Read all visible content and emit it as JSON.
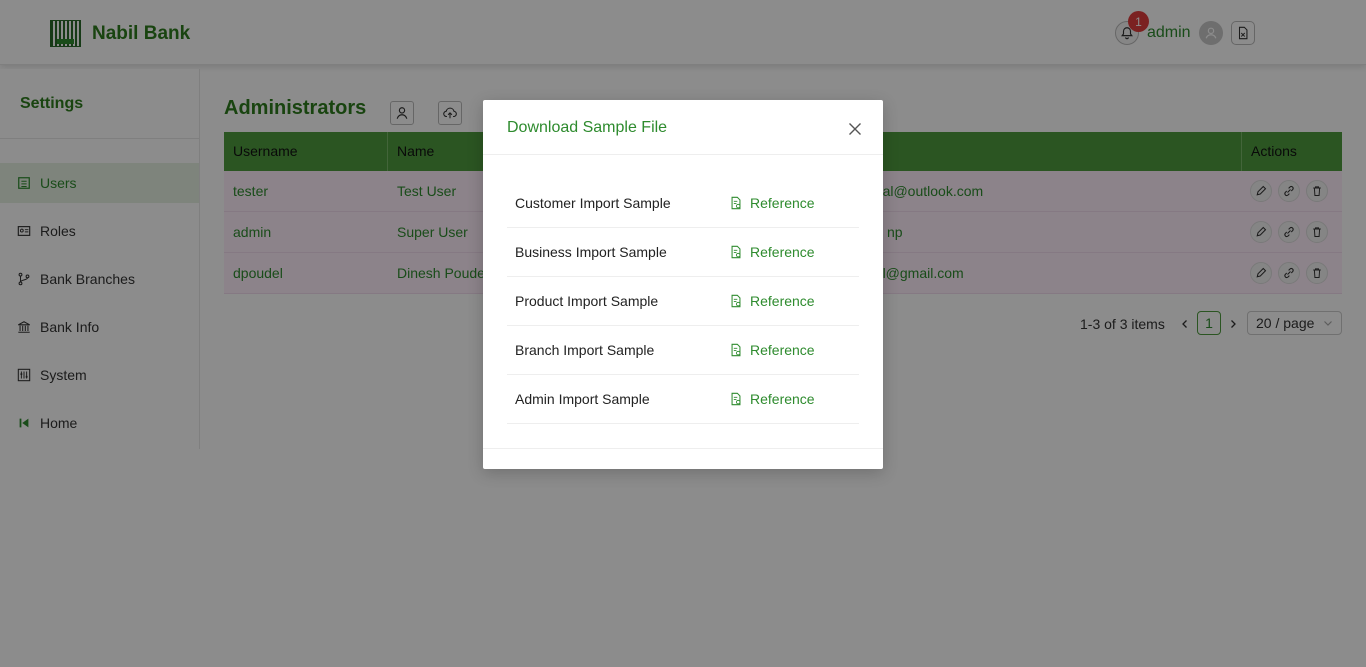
{
  "header": {
    "brand": "Nabil Bank",
    "notification_count": "1",
    "user_name": "admin"
  },
  "sidebar": {
    "title": "Settings",
    "items": [
      {
        "label": "Users",
        "icon": "users-icon",
        "active": true
      },
      {
        "label": "Roles",
        "icon": "id-card-icon",
        "active": false
      },
      {
        "label": "Bank Branches",
        "icon": "branch-icon",
        "active": false
      },
      {
        "label": "Bank Info",
        "icon": "bank-icon",
        "active": false
      },
      {
        "label": "System",
        "icon": "system-icon",
        "active": false
      },
      {
        "label": "Home",
        "icon": "home-back-icon",
        "active": false
      }
    ]
  },
  "main": {
    "title": "Administrators",
    "table": {
      "columns": [
        "Username",
        "Name",
        "",
        "Actions"
      ],
      "rows": [
        {
          "username": "tester",
          "name": "Test User",
          "email": "epal@outlook.com"
        },
        {
          "username": "admin",
          "name": "Super User",
          "email": "np"
        },
        {
          "username": "dpoudel",
          "name": "Dinesh Poude",
          "email": "pal@gmail.com"
        }
      ]
    },
    "pagination": {
      "summary": "1-3 of 3 items",
      "current_page": "1",
      "page_size": "20 / page"
    }
  },
  "modal": {
    "title": "Download Sample File",
    "samples": [
      {
        "name": "Customer Import Sample",
        "link": "Reference"
      },
      {
        "name": "Business Import Sample",
        "link": "Reference"
      },
      {
        "name": "Product Import Sample",
        "link": "Reference"
      },
      {
        "name": "Branch Import Sample",
        "link": "Reference"
      },
      {
        "name": "Admin Import Sample",
        "link": "Reference"
      }
    ]
  },
  "colors": {
    "brand_green": "#2e7d1e",
    "link_green": "#2e8b2e",
    "table_header": "#4f9c3f",
    "row_bg": "#ffeefc",
    "badge_red": "#e03c3c"
  }
}
